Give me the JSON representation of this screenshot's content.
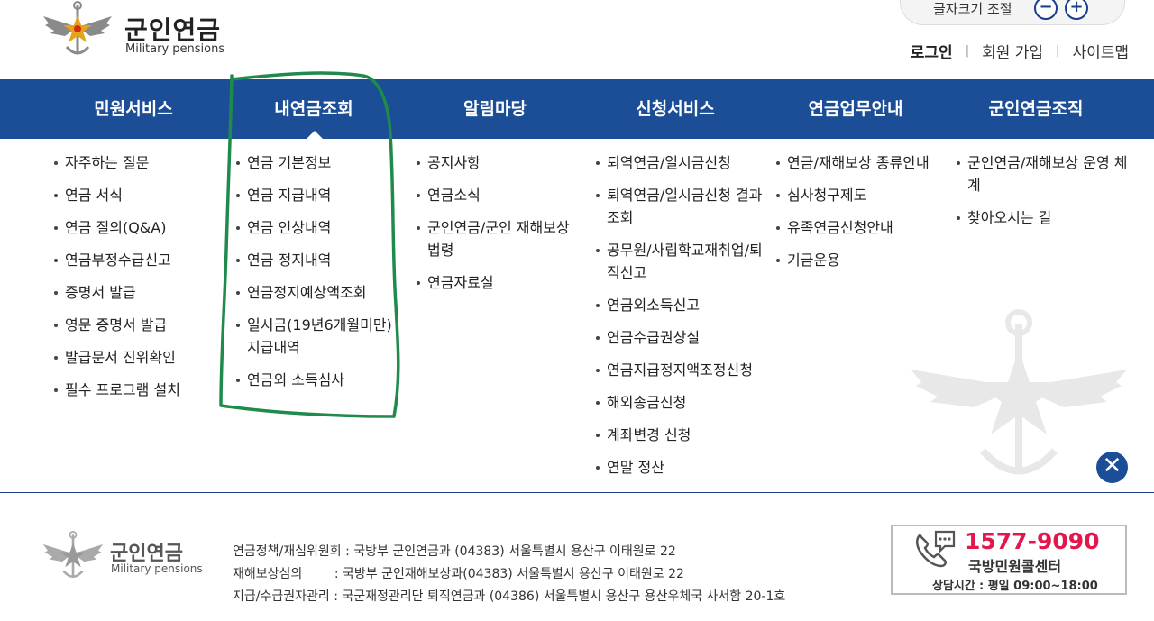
{
  "header": {
    "logo_title": "군인연금",
    "logo_subtitle": "Military pensions",
    "font_size_label": "글자크기 조절",
    "font_minus": "−",
    "font_plus": "+",
    "util_links": [
      "로그인",
      "회원 가입",
      "사이트맵"
    ]
  },
  "nav": [
    "민원서비스",
    "내연금조회",
    "알림마당",
    "신청서비스",
    "연금업무안내",
    "군인연금조직"
  ],
  "menu": {
    "col1": [
      "자주하는 질문",
      "연금 서식",
      "연금 질의(Q&A)",
      "연금부정수급신고",
      "증명서 발급",
      "영문 증명서 발급",
      "발급문서 진위확인",
      "필수 프로그램 설치"
    ],
    "col2": [
      "연금 기본정보",
      "연금 지급내역",
      "연금 인상내역",
      "연금 정지내역",
      "연금정지예상액조회",
      "일시금(19년6개월미만) 지급내역",
      "연금외 소득심사"
    ],
    "col3": [
      "공지사항",
      "연금소식",
      "군인연금/군인 재해보상 법령",
      "연금자료실"
    ],
    "col4": [
      "퇴역연금/일시금신청",
      "퇴역연금/일시금신청 결과조회",
      "공무원/사립학교재취업/퇴직신고",
      "연금외소득신고",
      "연금수급권상실",
      "연금지급정지액조정신청",
      "해외송금신청",
      "계좌변경 신청",
      "연말 정산"
    ],
    "col5": [
      "연금/재해보상 종류안내",
      "심사청구제도",
      "유족연금신청안내",
      "기금운용"
    ],
    "col6": [
      "군인연금/재해보상 운영 체계",
      "찾아오시는 길"
    ]
  },
  "close_label": "✕",
  "footer": {
    "logo_title": "군인연금",
    "logo_subtitle": "Military pensions",
    "address_lines": [
      "연금정책/재심위원회 : 국방부 군인연금과 (04383) 서울특별시 용산구 이태원로 22",
      "재해보상심의        : 국방부 군인재해보상과(04383) 서울특별시 용산구 이태원로 22",
      "지급/수급권자관리 : 국군재정관리단 퇴직연금과 (04386) 서울특별시 용산구 용산우체국 사서함 20-1호"
    ],
    "call_number": "1577-9090",
    "call_center": "국방민원콜센터",
    "call_hours_label": "상담시간",
    "call_hours": ": 평일 09:00~18:00"
  },
  "colors": {
    "nav_bg": "#1b4e96",
    "call_number": "#e3174e",
    "highlight": "#1f8a4c"
  }
}
